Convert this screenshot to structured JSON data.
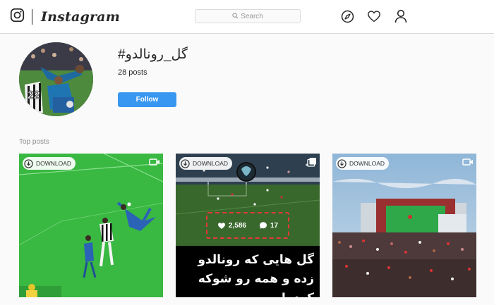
{
  "nav": {
    "brand": "Instagram",
    "search_placeholder": "Search",
    "icons": [
      "instagram-logo-icon",
      "search-icon",
      "compass-icon",
      "heart-icon",
      "profile-icon"
    ]
  },
  "header": {
    "hashtag": "#گل_رونالدو",
    "posts_count": "28 posts",
    "follow_label": "Follow"
  },
  "section": {
    "label": "Top posts"
  },
  "posts": [
    {
      "download_label": "DOWNLOAD",
      "type_icon": "video-icon"
    },
    {
      "download_label": "DOWNLOAD",
      "type_icon": "multiple-posts-icon",
      "likes": "2,586",
      "comments": "17",
      "caption": "گل هایی که رونالدو زده و همه رو شوکه کرده!"
    },
    {
      "download_label": "DOWNLOAD",
      "type_icon": "video-icon"
    }
  ],
  "colors": {
    "follow_button": "#3897f0",
    "highlight_dash": "#e53935",
    "divider": "#dbdbdb"
  }
}
